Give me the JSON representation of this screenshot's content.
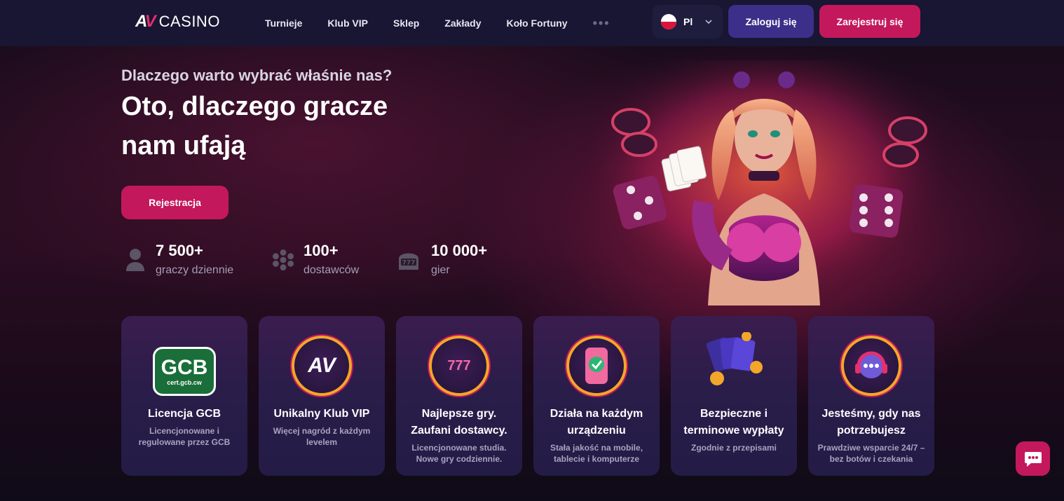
{
  "header": {
    "logo_mark_1": "A",
    "logo_mark_2": "V",
    "logo_text": "CASINO",
    "nav": [
      "Turnieje",
      "Klub VIP",
      "Sklep",
      "Zakłady",
      "Koło Fortuny"
    ],
    "nav_more": "•••",
    "language": "Pl",
    "login_label": "Zaloguj się",
    "register_label": "Zarejestruj się"
  },
  "hero": {
    "subtitle": "Dlaczego warto wybrać właśnie nas?",
    "title": "Oto, dlaczego gracze nam ufają",
    "cta_label": "Rejestracja",
    "stats": [
      {
        "icon": "user-icon",
        "value": "7 500+",
        "label": "graczy dziennie"
      },
      {
        "icon": "providers-icon",
        "value": "100+",
        "label": "dostawców"
      },
      {
        "icon": "slot-machine-icon",
        "value": "10 000+",
        "label": "gier"
      }
    ]
  },
  "cards": [
    {
      "icon": "gcb-license-badge",
      "badge_text": "GCB",
      "badge_sub": "cert.gcb.cw",
      "title": "Licencja GCB",
      "desc": "Licencjonowane i regulowane przez GCB"
    },
    {
      "icon": "av-logo-badge",
      "badge_text": "AV",
      "title": "Unikalny Klub VIP",
      "desc": "Więcej nagród z każdym levelem"
    },
    {
      "icon": "slots-ball-badge",
      "badge_text": "777",
      "title": "Najlepsze gry. Zaufani dostawcy.",
      "desc": "Licencjonowane studia. Nowe gry codziennie."
    },
    {
      "icon": "phone-check-badge",
      "badge_text": "✓",
      "title": "Działa na każdym urządzeniu",
      "desc": "Stała jakość na mobile, tablecie i komputerze"
    },
    {
      "icon": "cards-coins-icon",
      "badge_text": "",
      "title": "Bezpieczne i terminowe wypłaty",
      "desc": "Zgodnie z przepisami"
    },
    {
      "icon": "support-headset-badge",
      "badge_text": "•••",
      "title": "Jesteśmy, gdy nas potrzebujesz",
      "desc": "Prawdziwe wsparcie 24/7 – bez botów i czekania"
    }
  ],
  "colors": {
    "header_bg": "#181632",
    "accent_pink": "#c4185c",
    "accent_purple": "#3b2f8a",
    "badge_gold": "#f3a72a"
  }
}
